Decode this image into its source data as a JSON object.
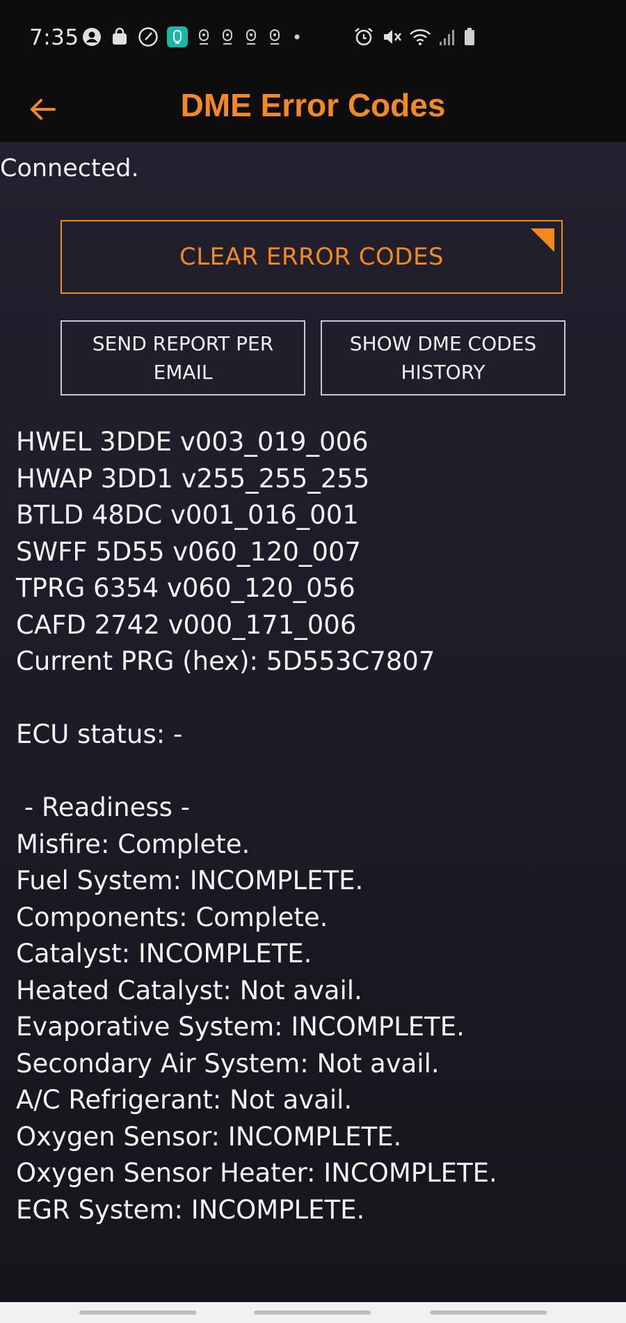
{
  "status_bar": {
    "time": "7:35",
    "left_icons": [
      "account-icon",
      "shopping-bag-icon",
      "clock-icon",
      "app-badge-icon",
      "location-pin-icon",
      "location-pin-icon",
      "location-pin-icon",
      "location-pin-icon",
      "dot-icon"
    ],
    "right_icons": [
      "alarm-icon",
      "mute-icon",
      "wifi-icon",
      "signal-icon",
      "battery-icon"
    ]
  },
  "app_bar": {
    "title": "DME Error Codes",
    "back_icon": "back-arrow-icon"
  },
  "colors": {
    "accent": "#f28a1f",
    "background": "#1c1b26",
    "text": "#f4f4f4"
  },
  "connection_status": "Connected.",
  "buttons": {
    "clear": "CLEAR ERROR CODES",
    "send_report": [
      "SEND REPORT PER",
      "EMAIL"
    ],
    "history": [
      "SHOW DME CODES",
      "HISTORY"
    ]
  },
  "info_lines": [
    "HWEL 3DDE v003_019_006",
    "HWAP 3DD1 v255_255_255",
    "BTLD 48DC v001_016_001",
    "SWFF 5D55 v060_120_007",
    "TPRG 6354 v060_120_056",
    "CAFD 2742 v000_171_006",
    "Current PRG (hex): 5D553C7807",
    "",
    "ECU status: -",
    "",
    " - Readiness -",
    "Misfire: Complete.",
    "Fuel System: INCOMPLETE.",
    "Components: Complete.",
    "Catalyst: INCOMPLETE.",
    "Heated Catalyst: Not avail.",
    "Evaporative System: INCOMPLETE.",
    "Secondary Air System: Not avail.",
    "A/C Refrigerant: Not avail.",
    "Oxygen Sensor: INCOMPLETE.",
    "Oxygen Sensor Heater: INCOMPLETE.",
    "EGR System: INCOMPLETE."
  ]
}
